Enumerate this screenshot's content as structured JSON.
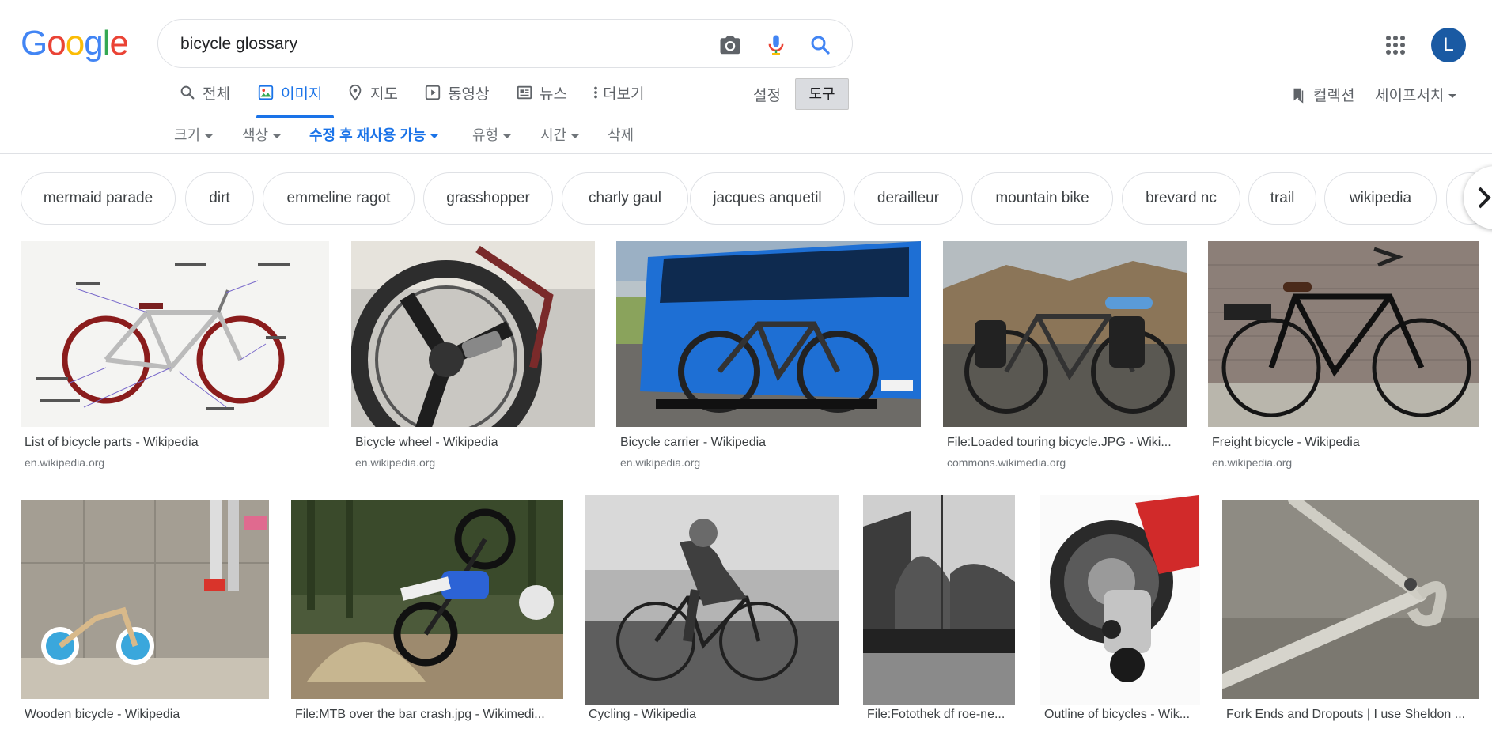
{
  "search": {
    "query": "bicycle glossary"
  },
  "header": {
    "avatar_letter": "L"
  },
  "tabs": [
    {
      "label": "전체",
      "icon": "search-icon"
    },
    {
      "label": "이미지",
      "icon": "image-icon",
      "active": true
    },
    {
      "label": "지도",
      "icon": "map-pin-icon"
    },
    {
      "label": "동영상",
      "icon": "video-icon"
    },
    {
      "label": "뉴스",
      "icon": "news-icon"
    },
    {
      "label": "더보기",
      "icon": "more-vertical-icon"
    }
  ],
  "settings_label": "설정",
  "tools_label": "도구",
  "collections_label": "컬렉션",
  "safesearch_label": "세이프서치",
  "filters": [
    {
      "label": "크기"
    },
    {
      "label": "색상"
    },
    {
      "label": "수정 후 재사용 가능",
      "active": true
    },
    {
      "label": "유형"
    },
    {
      "label": "시간"
    },
    {
      "label": "삭제"
    }
  ],
  "chips": [
    "mermaid parade",
    "dirt",
    "emmeline ragot",
    "grasshopper",
    "charly gaul",
    "jacques anquetil",
    "derailleur",
    "mountain bike",
    "brevard nc",
    "trail",
    "wikipedia"
  ],
  "results": [
    {
      "title": "List of bicycle parts - Wikipedia",
      "source": "en.wikipedia.org",
      "image": "bicycle-parts-diagram"
    },
    {
      "title": "Bicycle wheel - Wikipedia",
      "source": "en.wikipedia.org",
      "image": "bicycle-wheel-photo"
    },
    {
      "title": "Bicycle carrier - Wikipedia",
      "source": "en.wikipedia.org",
      "image": "bus-bike-carrier-photo"
    },
    {
      "title": "File:Loaded touring bicycle.JPG - Wiki...",
      "source": "commons.wikimedia.org",
      "image": "touring-bicycle-photo"
    },
    {
      "title": "Freight bicycle - Wikipedia",
      "source": "en.wikipedia.org",
      "image": "freight-bicycle-photo"
    },
    {
      "title": "Wooden bicycle - Wikipedia",
      "source": "",
      "image": "wooden-bicycle-photo"
    },
    {
      "title": "File:MTB over the bar crash.jpg - Wikimedi...",
      "source": "",
      "image": "mtb-crash-photo"
    },
    {
      "title": "Cycling - Wikipedia",
      "source": "",
      "image": "vintage-cyclist-photo"
    },
    {
      "title": "File:Fotothek df roe-ne...",
      "source": "",
      "image": "street-race-photo"
    },
    {
      "title": "Outline of bicycles - Wik...",
      "source": "",
      "image": "rear-derailleur-photo"
    },
    {
      "title": "Fork Ends and Dropouts | I use Sheldon ...",
      "source": "",
      "image": "fork-dropout-photo"
    }
  ],
  "colors": {
    "accent": "#1a73e8",
    "avatar_bg": "#1a5aa3"
  }
}
